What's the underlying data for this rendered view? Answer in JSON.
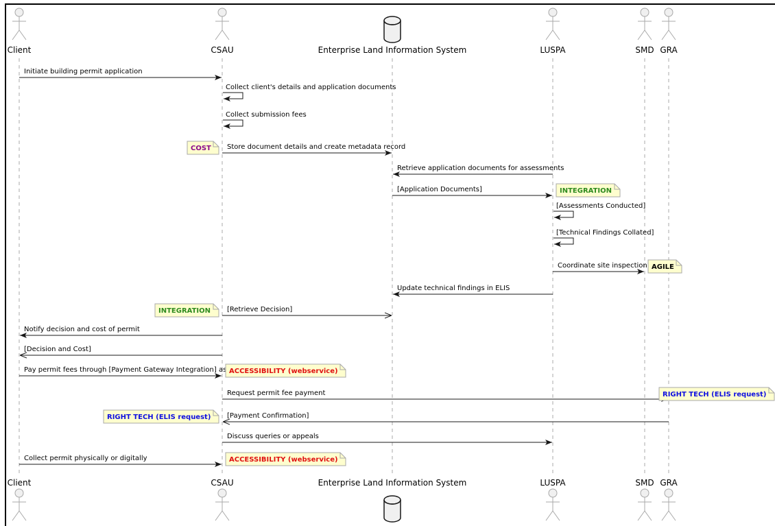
{
  "participants": [
    {
      "id": "client",
      "label": "Client",
      "kind": "actor"
    },
    {
      "id": "csau",
      "label": "CSAU",
      "kind": "actor"
    },
    {
      "id": "elis",
      "label": "Enterprise Land Information System",
      "kind": "database"
    },
    {
      "id": "luspa",
      "label": "LUSPA",
      "kind": "actor"
    },
    {
      "id": "smd",
      "label": "SMD",
      "kind": "actor"
    },
    {
      "id": "gra",
      "label": "GRA",
      "kind": "actor"
    }
  ],
  "messages": [
    {
      "from": "client",
      "to": "csau",
      "label": "Initiate building permit application",
      "style": "solid"
    },
    {
      "from": "csau",
      "to": "csau",
      "label": "Collect client's details and application documents",
      "style": "solid"
    },
    {
      "from": "csau",
      "to": "csau",
      "label": "Collect submission fees",
      "style": "solid"
    },
    {
      "from": "csau",
      "to": "elis",
      "label": "Store document details and create metadata record",
      "style": "solid"
    },
    {
      "from": "luspa",
      "to": "elis",
      "label": "Retrieve application documents for assessments",
      "style": "solid"
    },
    {
      "from": "elis",
      "to": "luspa",
      "label": "[Application Documents]",
      "style": "solid"
    },
    {
      "from": "luspa",
      "to": "luspa",
      "label": "[Assessments Conducted]",
      "style": "solid"
    },
    {
      "from": "luspa",
      "to": "luspa",
      "label": "[Technical Findings Collated]",
      "style": "solid"
    },
    {
      "from": "luspa",
      "to": "smd",
      "label": "Coordinate site inspection",
      "style": "solid"
    },
    {
      "from": "luspa",
      "to": "elis",
      "label": "Update technical findings in ELIS",
      "style": "solid"
    },
    {
      "from": "csau",
      "to": "elis",
      "label": "[Retrieve Decision]",
      "style": "open"
    },
    {
      "from": "csau",
      "to": "client",
      "label": "Notify decision and cost of permit",
      "style": "solid"
    },
    {
      "from": "csau",
      "to": "client",
      "label": "[Decision and Cost]",
      "style": "open"
    },
    {
      "from": "client",
      "to": "csau",
      "label": "Pay permit fees through [Payment Gateway Integration] as API",
      "style": "solid"
    },
    {
      "from": "csau",
      "to": "gra",
      "label": "Request permit fee payment",
      "style": "solid"
    },
    {
      "from": "gra",
      "to": "csau",
      "label": "[Payment Confirmation]",
      "style": "open"
    },
    {
      "from": "csau",
      "to": "luspa",
      "label": "Discuss queries or appeals",
      "style": "solid"
    },
    {
      "from": "client",
      "to": "csau",
      "label": "Collect permit physically or digitally",
      "style": "solid"
    }
  ],
  "notes": [
    {
      "message": 3,
      "side": "left",
      "text": "COST",
      "color": "#8b0a8b"
    },
    {
      "message": 5,
      "side": "right",
      "text": "INTEGRATION",
      "color": "#2e8b1f"
    },
    {
      "message": 8,
      "side": "right",
      "text": "AGILE",
      "color": "#000000"
    },
    {
      "message": 10,
      "side": "left",
      "text": "INTEGRATION",
      "color": "#2e8b1f"
    },
    {
      "message": 13,
      "side": "right",
      "text": "ACCESSIBILITY (webservice)",
      "color": "#e01010"
    },
    {
      "message": 14,
      "side": "right",
      "text": "RIGHT TECH (ELIS request)",
      "color": "#1010e0"
    },
    {
      "message": 15,
      "side": "left",
      "text": "RIGHT TECH (ELIS request)",
      "color": "#1010e0"
    },
    {
      "message": 17,
      "side": "right",
      "text": "ACCESSIBILITY (webservice)",
      "color": "#e01010"
    }
  ],
  "colors": {
    "note_fill": "#fefece",
    "note_border": "#a8a8a8",
    "lifeline": "#a8a8a8",
    "arrow": "#181818",
    "actor_stroke": "#a8a8a8"
  }
}
